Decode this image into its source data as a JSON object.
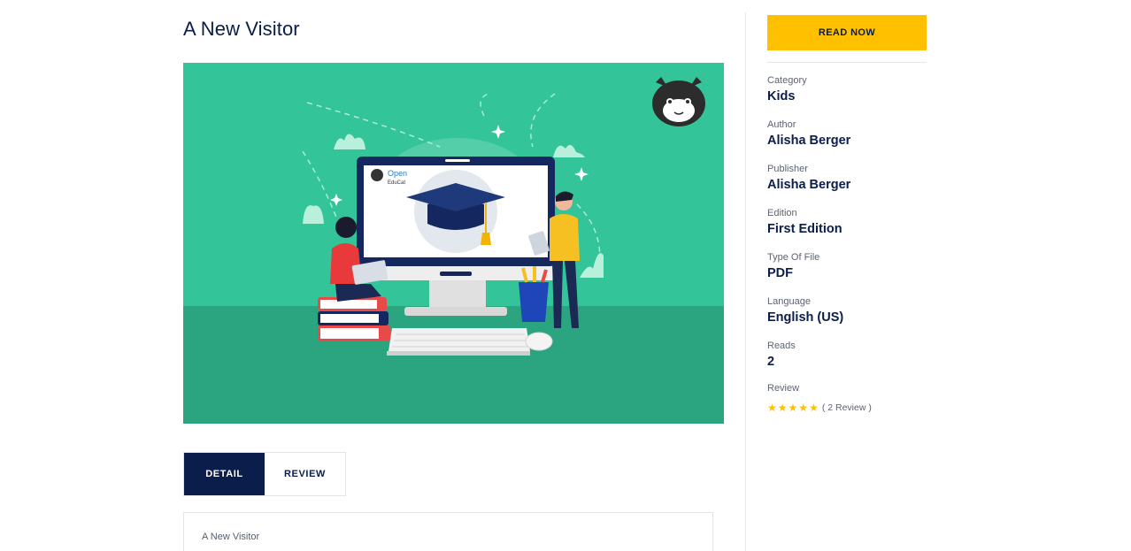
{
  "book": {
    "title": "A New Visitor",
    "description": "A New Visitor"
  },
  "cover": {
    "screen_brand_line1": "Open",
    "screen_brand_line2": "EduCat",
    "background_color": "#33c49a",
    "floor_color": "#2aa57f"
  },
  "tabs": [
    {
      "label": "DETAIL",
      "active": true
    },
    {
      "label": "REVIEW",
      "active": false
    }
  ],
  "sidebar": {
    "read_button": "READ NOW",
    "fields": [
      {
        "label": "Category",
        "value": "Kids"
      },
      {
        "label": "Author",
        "value": "Alisha Berger"
      },
      {
        "label": "Publisher",
        "value": "Alisha Berger"
      },
      {
        "label": "Edition",
        "value": "First Edition"
      },
      {
        "label": "Type Of File",
        "value": "PDF"
      },
      {
        "label": "Language",
        "value": "English (US)"
      },
      {
        "label": "Reads",
        "value": "2"
      }
    ],
    "review": {
      "label": "Review",
      "rating": 5,
      "max_rating": 5,
      "count_text": "( 2 Review )"
    }
  },
  "colors": {
    "navy": "#0b1d4a",
    "accent_yellow": "#ffc000"
  }
}
